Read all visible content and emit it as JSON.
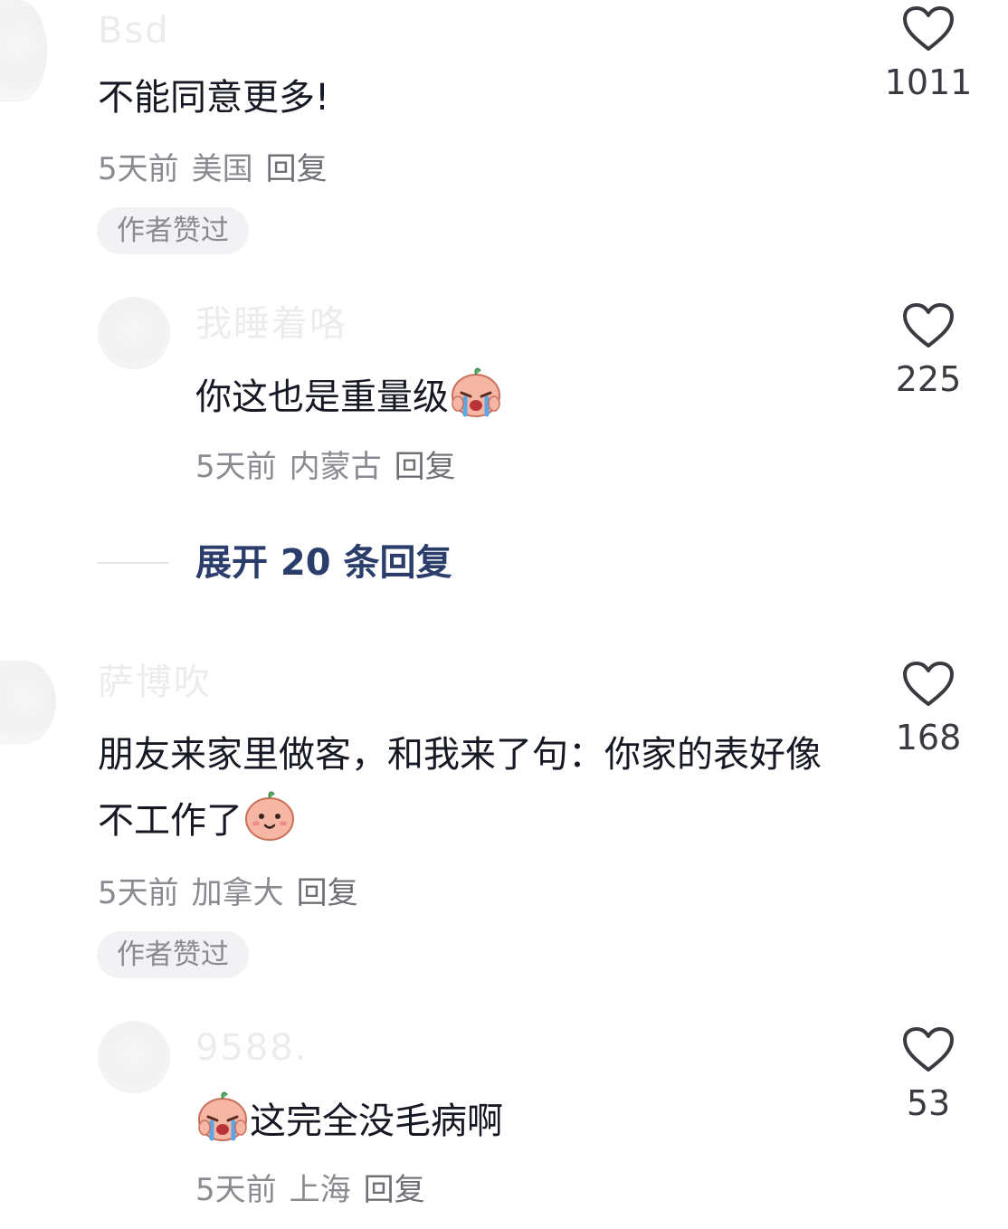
{
  "comments": [
    {
      "username": "Bsd",
      "text": "不能同意更多!",
      "time": "5天前",
      "location": "美国",
      "reply_label": "回复",
      "badge": "作者赞过",
      "likes": "1011"
    },
    {
      "username": "我睡着咯",
      "text": "你这也是重量级",
      "emoji": "crying-face-emoji",
      "time": "5天前",
      "location": "内蒙古",
      "reply_label": "回复",
      "likes": "225"
    },
    {
      "username": "萨博吹",
      "text": "朋友来家里做客，和我来了句：你家的表好像不工作了",
      "emoji": "smiling-face-emoji",
      "time": "5天前",
      "location": "加拿大",
      "reply_label": "回复",
      "badge": "作者赞过",
      "likes": "168"
    },
    {
      "username": "9588.",
      "text": "这完全没毛病啊",
      "emoji": "crying-face-emoji",
      "time": "5天前",
      "location": "上海",
      "reply_label": "回复",
      "likes": "53"
    }
  ],
  "expand": {
    "label": "展开 20 条回复"
  },
  "colors": {
    "text": "#161823",
    "meta": "#8a8b91",
    "expand": "#2a3d6b",
    "badge_bg": "#f2f2f4"
  }
}
